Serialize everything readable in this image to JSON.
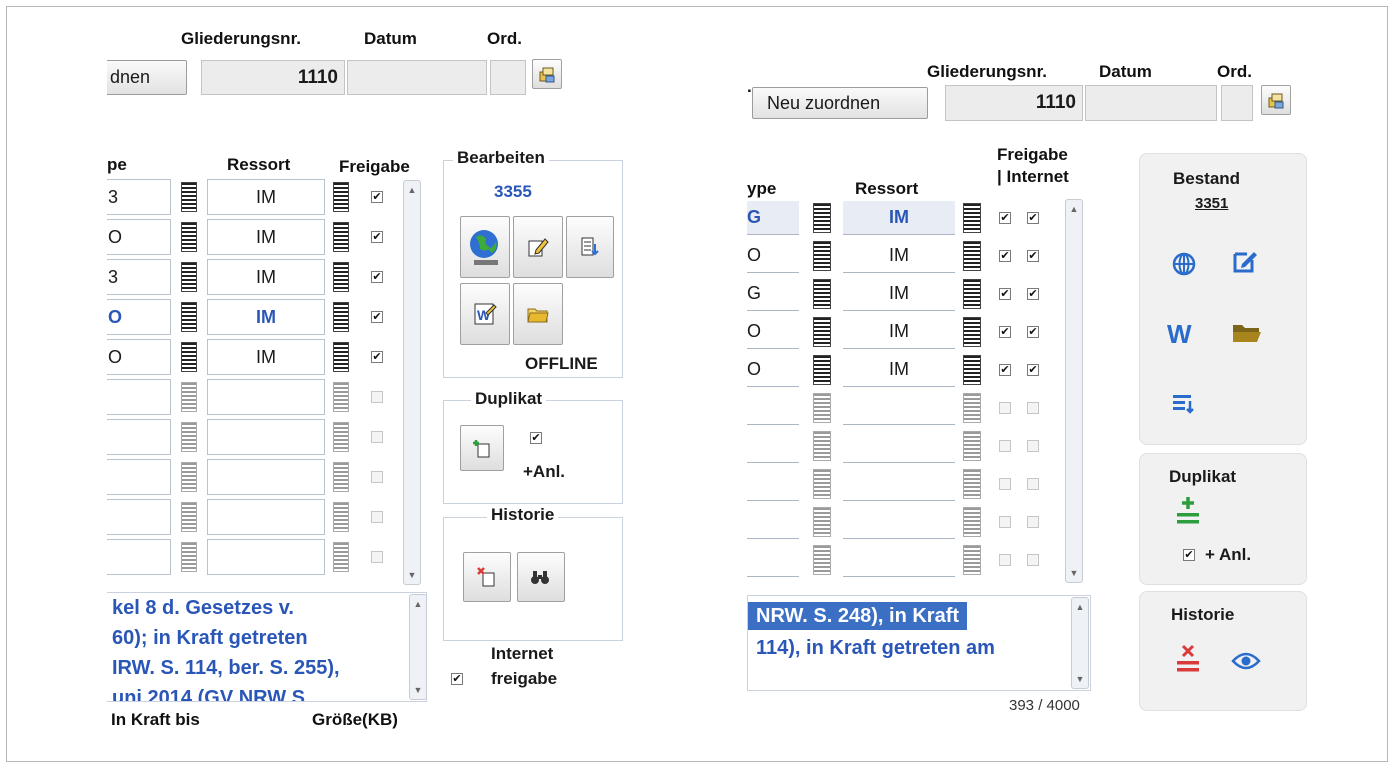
{
  "left": {
    "header": {
      "col_gliederung": "Gliederungsnr.",
      "col_datum": "Datum",
      "col_ord": "Ord.",
      "assign_button": "dnen",
      "gliederung_value": "1110"
    },
    "table": {
      "col_typ": "pe",
      "col_ressort": "Ressort",
      "col_freigabe": "Freigabe",
      "rows": [
        {
          "typ": "3",
          "ressort": "IM",
          "checked": true,
          "highlight": false
        },
        {
          "typ": "O",
          "ressort": "IM",
          "checked": true,
          "highlight": false
        },
        {
          "typ": "3",
          "ressort": "IM",
          "checked": true,
          "highlight": false
        },
        {
          "typ": "O",
          "ressort": "IM",
          "checked": true,
          "highlight": true
        },
        {
          "typ": "O",
          "ressort": "IM",
          "checked": true,
          "highlight": false
        },
        {
          "typ": "",
          "ressort": "",
          "checked": false,
          "highlight": false
        },
        {
          "typ": "",
          "ressort": "",
          "checked": false,
          "highlight": false
        },
        {
          "typ": "",
          "ressort": "",
          "checked": false,
          "highlight": false
        },
        {
          "typ": "",
          "ressort": "",
          "checked": false,
          "highlight": false
        },
        {
          "typ": "",
          "ressort": "",
          "checked": false,
          "highlight": false
        }
      ]
    },
    "bearbeiten": {
      "title": "Bearbeiten",
      "count": "3355",
      "status": "OFFLINE"
    },
    "duplikat": {
      "title": "Duplikat",
      "anl_label": "+Anl."
    },
    "historie": {
      "title": "Historie"
    },
    "note_lines": [
      "kel 8 d. Gesetzes v.",
      "60);   in Kraft getreten",
      "IRW. S. 114, ber. S. 255),",
      "uni   2014 (GV  NRW  S"
    ],
    "internet_freigabe": [
      "Internet",
      "freigabe"
    ],
    "footer": {
      "in_kraft_bis": "In Kraft bis",
      "groesse": "Größe(KB)"
    }
  },
  "right": {
    "header": {
      "dot": ".",
      "col_gliederung": "Gliederungsnr.",
      "col_datum": "Datum",
      "col_ord": "Ord.",
      "assign_button": "Neu zuordnen",
      "gliederung_value": "1110"
    },
    "table": {
      "col_typ": "ype",
      "col_ressort": "Ressort",
      "col_freigabe_1": "Freigabe",
      "col_freigabe_2": "| Internet",
      "rows": [
        {
          "typ": "G",
          "ressort": "IM",
          "freigabe": true,
          "internet": true,
          "highlight": true
        },
        {
          "typ": "O",
          "ressort": "IM",
          "freigabe": true,
          "internet": true,
          "highlight": false
        },
        {
          "typ": "G",
          "ressort": "IM",
          "freigabe": true,
          "internet": true,
          "highlight": false
        },
        {
          "typ": "O",
          "ressort": "IM",
          "freigabe": true,
          "internet": true,
          "highlight": false
        },
        {
          "typ": "O",
          "ressort": "IM",
          "freigabe": true,
          "internet": true,
          "highlight": false
        },
        {
          "typ": "",
          "ressort": "",
          "freigabe": false,
          "internet": false,
          "highlight": false
        },
        {
          "typ": "",
          "ressort": "",
          "freigabe": false,
          "internet": false,
          "highlight": false
        },
        {
          "typ": "",
          "ressort": "",
          "freigabe": false,
          "internet": false,
          "highlight": false
        },
        {
          "typ": "",
          "ressort": "",
          "freigabe": false,
          "internet": false,
          "highlight": false
        },
        {
          "typ": "",
          "ressort": "",
          "freigabe": false,
          "internet": false,
          "highlight": false
        }
      ]
    },
    "note_line1": "NRW. S. 248), in Kraft",
    "note_line2": "114), in   Kraft getreten am",
    "char_counter": "393 / 4000",
    "bestand": {
      "title": "Bestand",
      "count": "3351"
    },
    "duplikat": {
      "title": "Duplikat",
      "anl_label": "+ Anl."
    },
    "historie": {
      "title": "Historie"
    }
  },
  "colors": {
    "link_blue": "#2a56b8",
    "green_plus": "#2e9d3e",
    "red_x": "#d93b3b",
    "folder": "#a8841d"
  }
}
